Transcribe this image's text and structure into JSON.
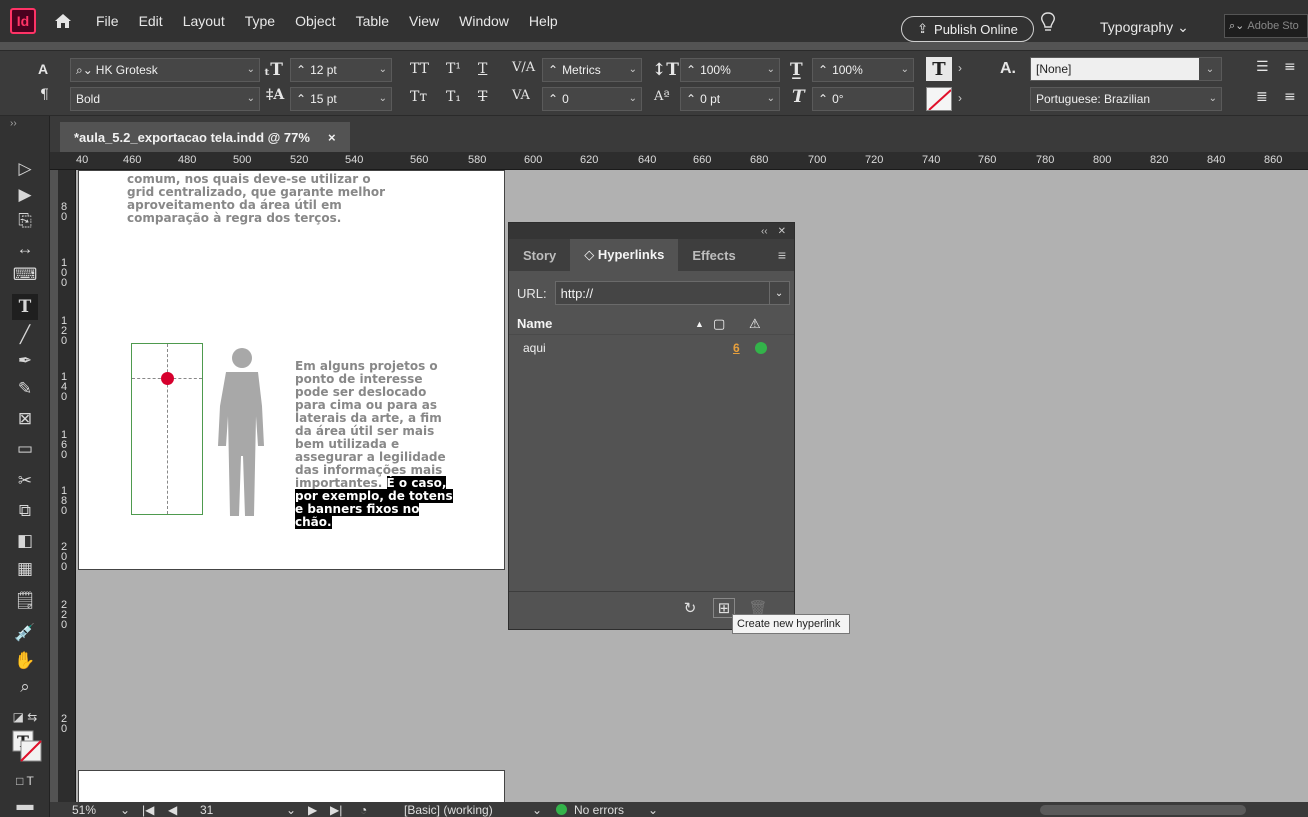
{
  "app": {
    "logo": "Id"
  },
  "menu": [
    "File",
    "Edit",
    "Layout",
    "Type",
    "Object",
    "Table",
    "View",
    "Window",
    "Help"
  ],
  "publish_label": "Publish Online",
  "workspace": "Typography",
  "search_placeholder": "Adobe Sto",
  "control": {
    "font_family": "HK Grotesk",
    "font_style": "Bold",
    "font_size": "12 pt",
    "leading": "15 pt",
    "kerning": "Metrics",
    "tracking": "0",
    "vscale": "100%",
    "hscale": "100%",
    "baseline": "0 pt",
    "skew": "0°",
    "char_style": "[None]",
    "language": "Portuguese: Brazilian"
  },
  "document": {
    "tab_title": "*aula_5.2_exportacao tela.indd @ 77%",
    "close": "×"
  },
  "ruler_h": [
    "40",
    "460",
    "480",
    "500",
    "520",
    "540",
    "560",
    "580",
    "600",
    "620",
    "640",
    "660",
    "680",
    "700",
    "720",
    "740",
    "760",
    "780",
    "800",
    "820",
    "840",
    "860"
  ],
  "ruler_v": [
    "8\n0",
    "1\n0\n0",
    "1\n2\n0",
    "1\n4\n0",
    "1\n6\n0",
    "1\n8\n0",
    "2\n0\n0",
    "2\n2\n0",
    "2\n0"
  ],
  "page": {
    "para_top": "comum, nos quais deve-se utilizar o grid centralizado, que garante melhor aproveitamento da área útil em comparação à regra dos terços.",
    "para_right_plain": "Em alguns projetos o ponto de interesse pode ser deslocado para cima ou para as laterais da arte, a fim da área útil ser mais bem utilizada e assegurar a legilidade das informações mais importantes.",
    "para_right_selected": "É o caso, por exemplo, de totens e banners fixos no chão."
  },
  "hyperlinks_panel": {
    "collapse": "‹‹",
    "close": "✕",
    "tabs": [
      "Story",
      "◇ Hyperlinks",
      "Effects"
    ],
    "url_label": "URL:",
    "url_value": "http://",
    "name_header": "Name",
    "rows": [
      {
        "name": "aqui",
        "page": "6",
        "status_color": "#33b34a"
      }
    ],
    "tooltip": "Create new hyperlink"
  },
  "status": {
    "zoom": "51%",
    "page": "31",
    "preflight_profile": "[Basic] (working)",
    "errors": "No errors"
  },
  "colors": {
    "accent": "#ff3366",
    "panel": "#535353",
    "canvas": "#b1b1b1",
    "ok": "#33b34a"
  }
}
